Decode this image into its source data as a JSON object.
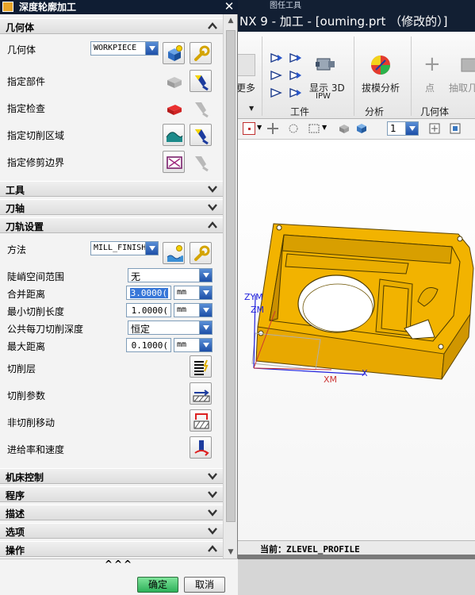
{
  "app": {
    "menu_top": "图任工具",
    "title": "NX 9 - 加工 - [ouming.prt （修改的）]",
    "ribbon": {
      "partial_left_label": "更多",
      "show_3d_label": "显示 3D",
      "show_3d_sub": "IPW",
      "draft_analysis_label": "拔模分析",
      "point_label": "点",
      "extract_label": "抽取几",
      "groups": [
        "工件",
        "分析",
        "几何体"
      ]
    },
    "toolbar2": {
      "layer_value": "1"
    },
    "viewport": {
      "axis_labels": [
        "ZYM",
        "ZM",
        "XM",
        "X"
      ],
      "part_color": "#f0b400"
    },
    "status": {
      "current_text": "当前：ZLEVEL_PROFILE"
    }
  },
  "dialog": {
    "title": "深度轮廓加工",
    "sections": {
      "geometry": "几何体",
      "tool": "工具",
      "tool_axis": "刀轴",
      "path_settings": "刀轨设置",
      "machine_control": "机床控制",
      "program": "程序",
      "description": "描述",
      "options": "选项",
      "actions": "操作"
    },
    "geometry": {
      "geometry_label": "几何体",
      "geometry_value": "WORKPIECE",
      "specify_part": "指定部件",
      "specify_check": "指定检查",
      "specify_cut_area": "指定切削区域",
      "specify_trim": "指定修剪边界"
    },
    "path": {
      "method_label": "方法",
      "method_value": "MILL_FINISH",
      "steep_label": "陡峭空间范围",
      "steep_value": "无",
      "merge_label": "合并距离",
      "merge_value": "3.0000(",
      "merge_unit": "mm",
      "min_cut_label": "最小切削长度",
      "min_cut_value": "1.0000(",
      "min_cut_unit": "mm",
      "depth_label": "公共每刀切削深度",
      "depth_value": "恒定",
      "max_dist_label": "最大距离",
      "max_dist_value": "0.1000(",
      "max_dist_unit": "mm",
      "cut_levels": "切削层",
      "cut_params": "切削参数",
      "non_cut": "非切削移动",
      "feeds": "进给率和速度"
    },
    "footer": {
      "collapse": "^^^",
      "ok": "确定",
      "cancel": "取消"
    }
  }
}
